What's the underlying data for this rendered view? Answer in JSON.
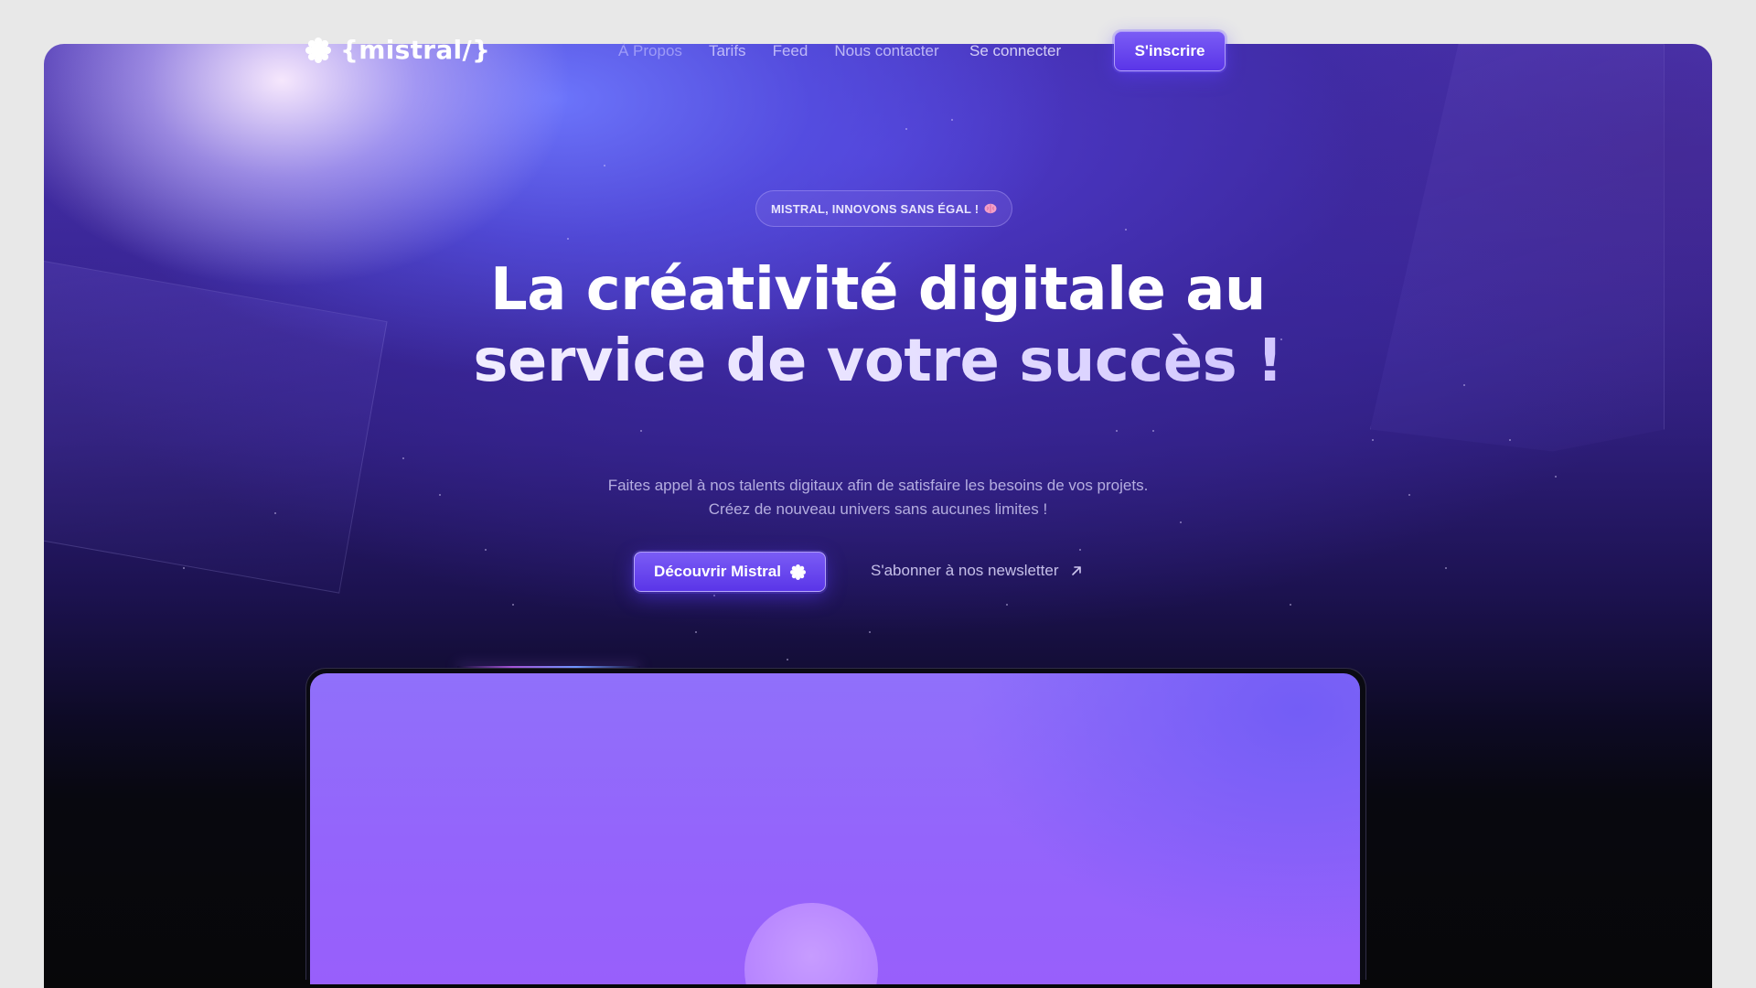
{
  "brand": {
    "name": "{mistral/}",
    "icon": "burst-icon"
  },
  "nav": {
    "links": [
      "À Propos",
      "Tarifs",
      "Feed",
      "Nous contacter"
    ],
    "login_label": "Se connecter",
    "signup_label": "S'inscrire"
  },
  "hero": {
    "badge": "MISTRAL, INNOVONS SANS ÉGAL !",
    "badge_icon": "brain-icon",
    "title_line1": "La créativité digitale au",
    "title_line2": "service de votre succès !",
    "subtitle_line1": "Faites appel à nos talents digitaux afin de satisfaire les besoins de vos projets.",
    "subtitle_line2": "Créez de nouveau univers sans aucunes limites !",
    "cta_label": "Découvrir Mistral",
    "cta_icon": "burst-icon",
    "newsletter_label": "S'abonner à nos newsletter",
    "newsletter_icon": "arrow-up-right-icon"
  },
  "colors": {
    "accent": "#6a45f0",
    "preview_bg": "#9464fb",
    "page_bg": "#e8e8e8"
  }
}
